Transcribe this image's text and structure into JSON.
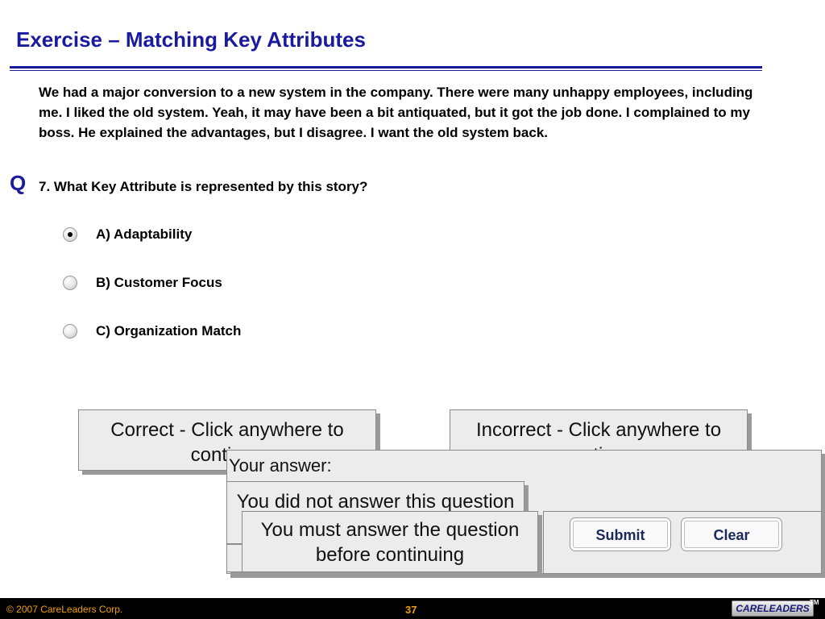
{
  "slide": {
    "title": "Exercise – Matching Key Attributes",
    "story": "We had a major conversion to a new system in the company. There were many unhappy employees, including me. I liked the old system. Yeah, it may have been a bit antiquated, but it got the job done. I complained to my boss. He explained the advantages, but I disagree. I want the old system back.",
    "q_mark": "Q",
    "question": "7.  What Key Attribute is represented by this story?",
    "options": [
      {
        "label": "A) Adaptability",
        "selected": true
      },
      {
        "label": "B) Customer Focus",
        "selected": false
      },
      {
        "label": "C) Organization Match",
        "selected": false
      }
    ]
  },
  "popups": {
    "correct": "Correct - Click anywhere to continue",
    "incorrect": "Incorrect - Click anywhere to continue",
    "your_answer": "Your answer:",
    "not_answered": "You did not answer this question completely",
    "must_answer": "You must answer the question before continuing"
  },
  "buttons": {
    "submit": "Submit",
    "clear": "Clear"
  },
  "footer": {
    "copyright": "© 2007 CareLeaders Corp.",
    "page_number": "37",
    "logo_text": "CARELEADERS",
    "trademark": "TM"
  },
  "colors": {
    "title_blue": "#1a1a9c",
    "footer_accent": "#f0a000",
    "popup_bg": "#ececec"
  }
}
